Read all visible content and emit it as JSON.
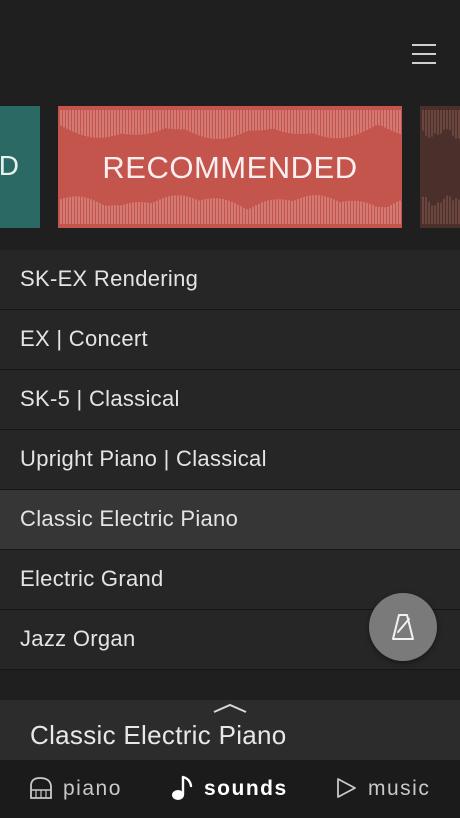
{
  "carousel": {
    "prev_card_label": "D",
    "main_card_label": "RECOMMENDED",
    "colors": {
      "prev": "#2b6a64",
      "main": "#c4554d",
      "next": "#4a2f2a"
    }
  },
  "sound_list": [
    {
      "label": "SK-EX Rendering"
    },
    {
      "label": "EX | Concert"
    },
    {
      "label": "SK-5 | Classical"
    },
    {
      "label": "Upright Piano | Classical"
    },
    {
      "label": "Classic Electric Piano",
      "selected": true
    },
    {
      "label": "Electric Grand"
    },
    {
      "label": "Jazz Organ"
    }
  ],
  "now_playing": {
    "title": "Classic Electric Piano"
  },
  "tabs": {
    "piano": "piano",
    "sounds": "sounds",
    "music": "music",
    "active": "sounds"
  },
  "icons": {
    "menu": "hamburger-menu-icon",
    "fab": "metronome-icon",
    "expand": "chevron-up-icon",
    "piano": "piano-icon",
    "sounds": "music-note-icon",
    "music": "play-icon"
  }
}
